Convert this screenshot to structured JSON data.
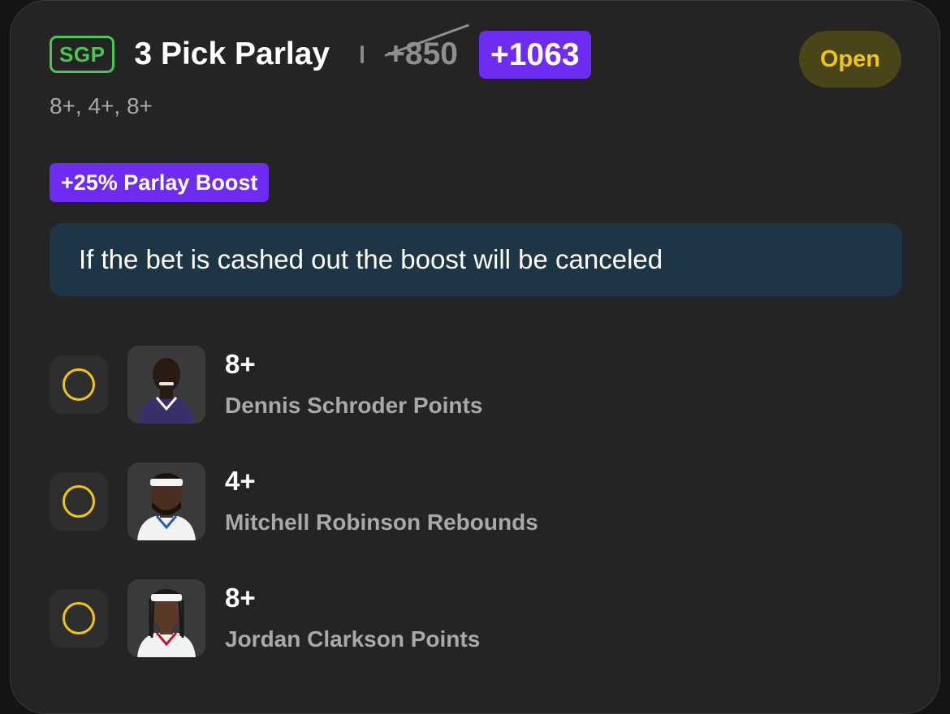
{
  "bet": {
    "sgp_label": "SGP",
    "title": "3 Pick Parlay",
    "original_odds": "+850",
    "boosted_odds": "+1063",
    "status": "Open",
    "summary": "8+, 4+, 8+"
  },
  "boost": {
    "label": "+25% Parlay Boost",
    "notice": "If the bet is cashed out the boost will be canceled"
  },
  "legs": [
    {
      "line": "8+",
      "market": "Dennis Schroder Points",
      "jersey_color": "#3a2f6b"
    },
    {
      "line": "4+",
      "market": "Mitchell Robinson Rebounds",
      "jersey_color": "#f2f2f2"
    },
    {
      "line": "8+",
      "market": "Jordan Clarkson Points",
      "jersey_color": "#f2f2f2"
    }
  ],
  "colors": {
    "card_bg": "#242424",
    "accent_purple": "#6e2cf2",
    "sgp_green": "#4cc552",
    "status_yellow": "#f4c414",
    "notice_bg": "#1d3545"
  }
}
